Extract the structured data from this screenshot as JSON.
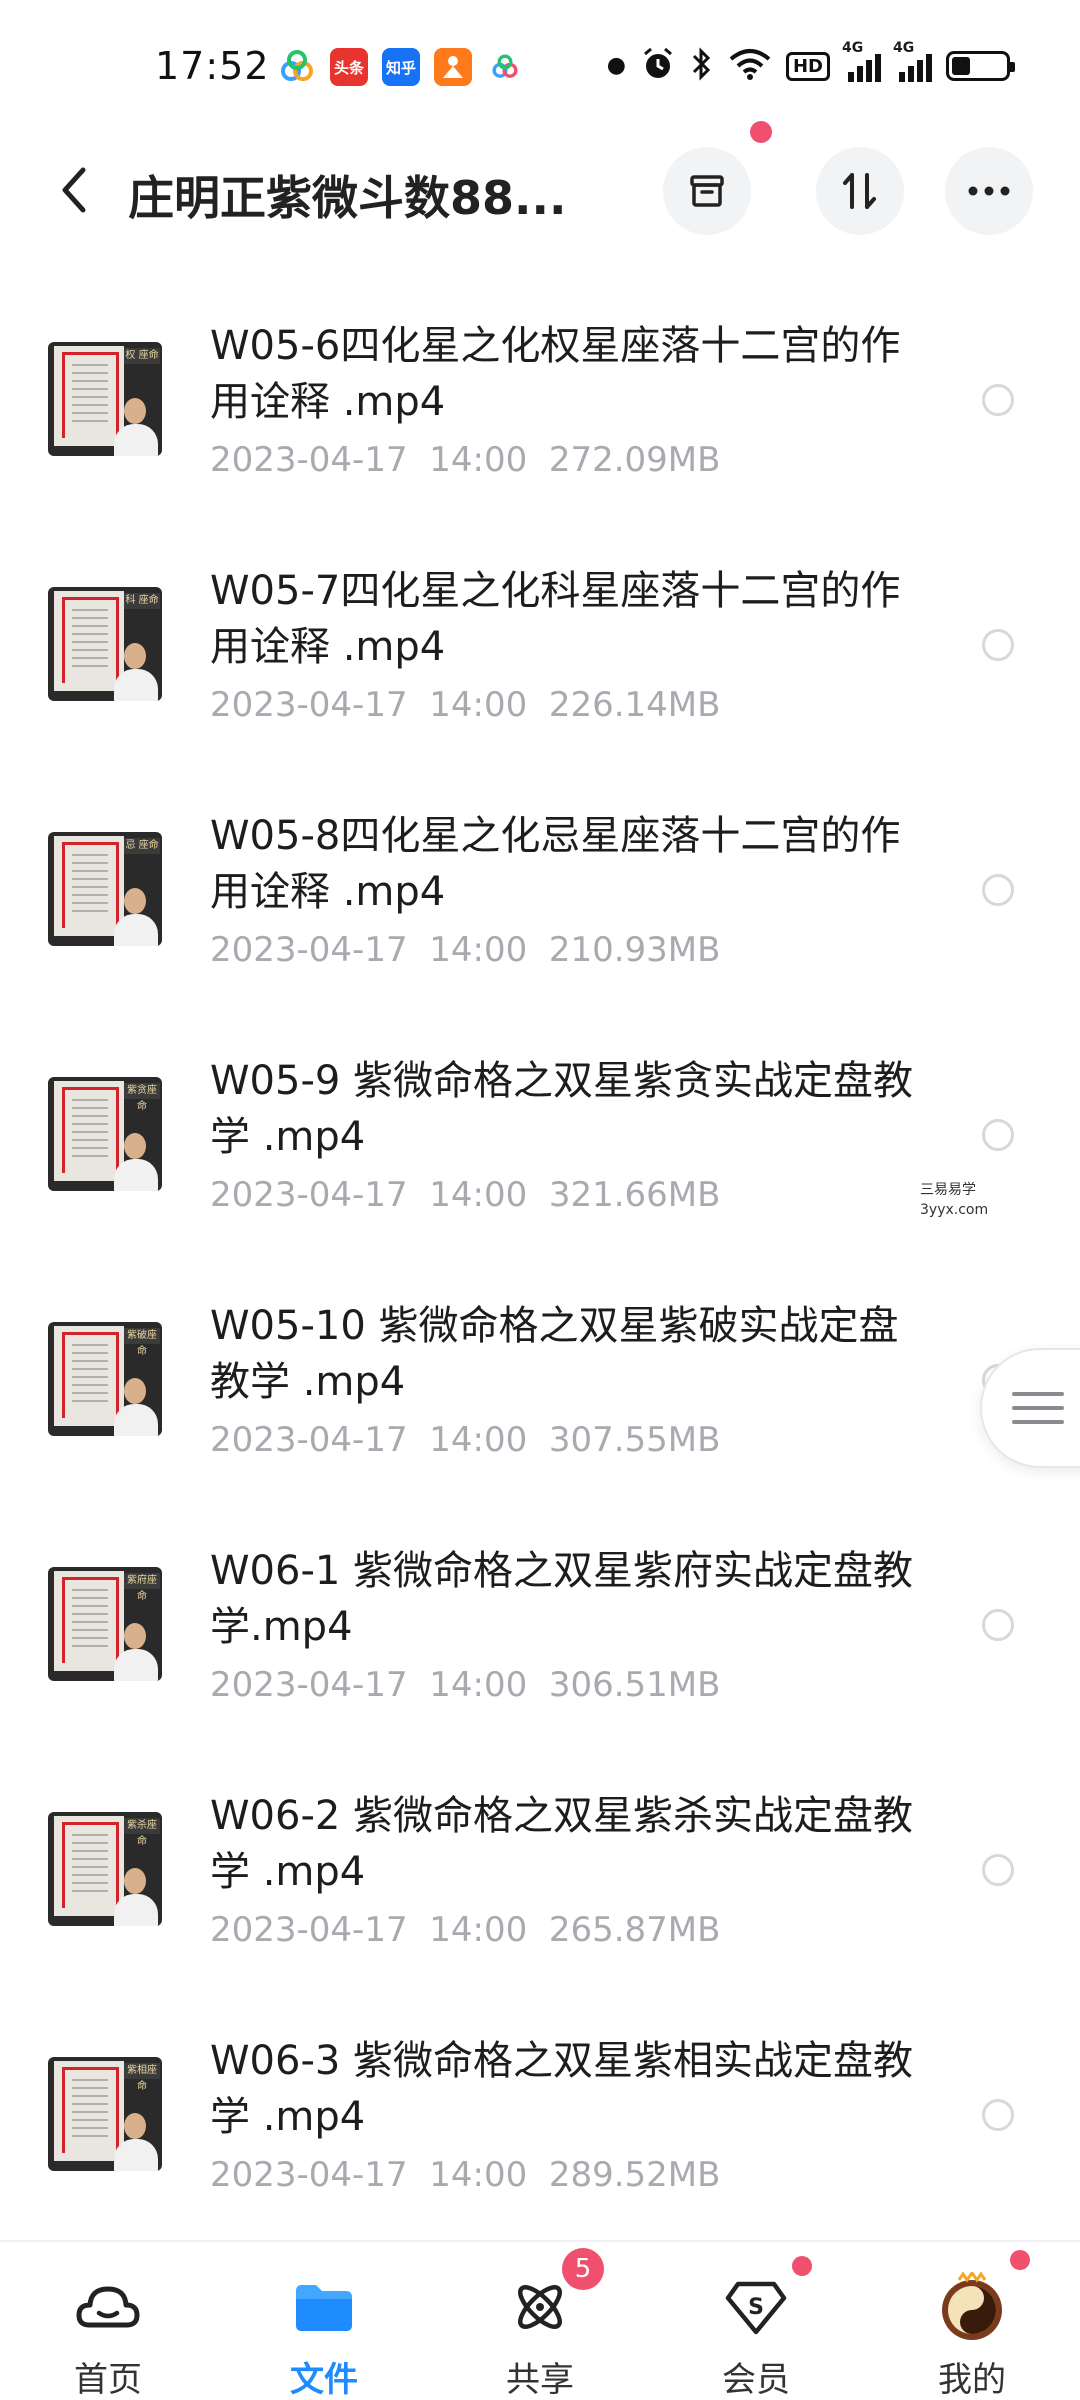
{
  "status_bar": {
    "time": "17:52",
    "apps": [
      {
        "icon": "cloud-app-icon",
        "color": "#3aa0ff",
        "text": ""
      },
      {
        "icon": "toutiao-app-icon",
        "color": "#e8342e",
        "text": "头条"
      },
      {
        "icon": "zhihu-app-icon",
        "color": "#1772f6",
        "text": "知乎"
      },
      {
        "icon": "orange-app-icon",
        "color": "#ff7a1a",
        "text": ""
      },
      {
        "icon": "cloud-app-icon-2",
        "color": "#3aa0ff",
        "text": ""
      }
    ],
    "hd_label": "HD",
    "network_label": "4G",
    "battery_level": 0.35
  },
  "appbar": {
    "title": "庄明正紫微斗数88..."
  },
  "files": [
    {
      "name": "W05-6四化星之化权星座落十二宫的作用诠释 .mp4",
      "date": "2023-04-17",
      "time": "14:00",
      "size": "272.09MB",
      "thumb_label": "权 座命"
    },
    {
      "name": "W05-7四化星之化科星座落十二宫的作用诠释 .mp4",
      "date": "2023-04-17",
      "time": "14:00",
      "size": "226.14MB",
      "thumb_label": "科 座命"
    },
    {
      "name": "W05-8四化星之化忌星座落十二宫的作用诠释 .mp4",
      "date": "2023-04-17",
      "time": "14:00",
      "size": "210.93MB",
      "thumb_label": "忌 座命"
    },
    {
      "name": "W05-9 紫微命格之双星紫贪实战定盘教学 .mp4",
      "date": "2023-04-17",
      "time": "14:00",
      "size": "321.66MB",
      "thumb_label": "紫贪座命"
    },
    {
      "name": "W05-10 紫微命格之双星紫破实战定盘教学 .mp4",
      "date": "2023-04-17",
      "time": "14:00",
      "size": "307.55MB",
      "thumb_label": "紫破座命"
    },
    {
      "name": "W06-1 紫微命格之双星紫府实战定盘教学.mp4",
      "date": "2023-04-17",
      "time": "14:00",
      "size": "306.51MB",
      "thumb_label": "紫府座命"
    },
    {
      "name": "W06-2 紫微命格之双星紫杀实战定盘教学 .mp4",
      "date": "2023-04-17",
      "time": "14:00",
      "size": "265.87MB",
      "thumb_label": "紫杀座命"
    },
    {
      "name": "W06-3 紫微命格之双星紫相实战定盘教学 .mp4",
      "date": "2023-04-17",
      "time": "14:00",
      "size": "289.52MB",
      "thumb_label": "紫相座命"
    }
  ],
  "watermark": {
    "line1": "三易易学",
    "line2": "3yyx.com"
  },
  "bottom_nav": {
    "items": [
      {
        "label": "首页",
        "icon": "home-cloud-icon"
      },
      {
        "label": "文件",
        "icon": "folder-icon"
      },
      {
        "label": "共享",
        "icon": "share-atom-icon",
        "badge": "5"
      },
      {
        "label": "会员",
        "icon": "member-diamond-icon"
      },
      {
        "label": "我的",
        "icon": "avatar-icon"
      }
    ]
  },
  "colors": {
    "accent": "#1e8bff",
    "badge": "#f0506e",
    "meta_text": "#a9aab0"
  }
}
